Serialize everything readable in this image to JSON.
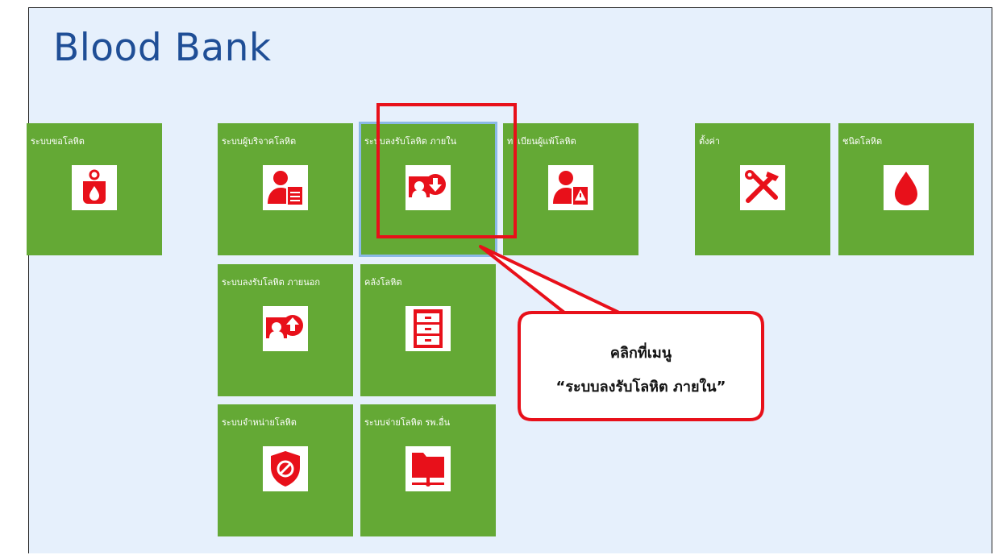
{
  "app": {
    "title": "Blood Bank",
    "top_fragment": "ู"
  },
  "tiles": [
    {
      "label": "ระบบขอโลหิต",
      "icon": "blood-bag-icon"
    },
    {
      "label": "ระบบผู้บริจาคโลหิต",
      "icon": "donor-document-icon"
    },
    {
      "label": "ระบบลงรับโลหิต ภายใน",
      "icon": "receive-internal-icon"
    },
    {
      "label": "ทะเบียนผู้แพ้โลหิต",
      "icon": "allergy-user-icon"
    },
    {
      "label": "ตั้งค่า",
      "icon": "tools-icon"
    },
    {
      "label": "ชนิดโลหิต",
      "icon": "blood-drop-icon"
    },
    {
      "label": "ระบบลงรับโลหิต ภายนอก",
      "icon": "receive-external-icon"
    },
    {
      "label": "คลังโลหิต",
      "icon": "cabinet-icon"
    },
    {
      "label": "ระบบจำหน่ายโลหิต",
      "icon": "shield-block-icon"
    },
    {
      "label": "ระบบจ่ายโลหิต รพ.อื่น",
      "icon": "network-folder-icon"
    }
  ],
  "callout": {
    "line1": "คลิกที่เมนู",
    "line2": "“ระบบลงรับโลหิต ภายใน”"
  },
  "colors": {
    "tile": "#64a935",
    "title": "#1f4e96",
    "panel": "#e6f0fc",
    "highlight": "#e8101a",
    "icon_red": "#e8101a"
  }
}
